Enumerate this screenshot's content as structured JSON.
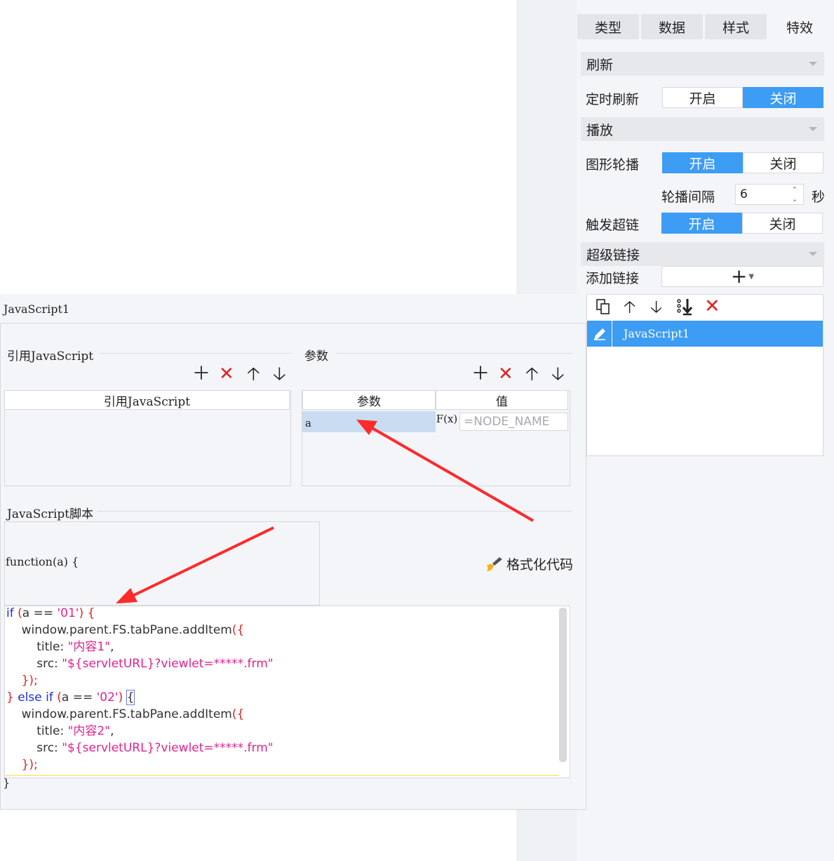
{
  "tabs": [
    {
      "label": "类型",
      "active": false
    },
    {
      "label": "数据",
      "active": false
    },
    {
      "label": "样式",
      "active": false
    },
    {
      "label": "特效",
      "active": true
    }
  ],
  "refresh": {
    "section": "刷新",
    "timer_label": "定时刷新",
    "on": "开启",
    "off": "关闭",
    "selected": "关闭"
  },
  "playback": {
    "section": "播放",
    "carousel_label": "图形轮播",
    "on": "开启",
    "off": "关闭",
    "selected": "开启",
    "interval_label": "轮播间隔",
    "interval_value": "6",
    "interval_unit": "秒",
    "trigger_label": "触发超链",
    "trigger_on": "开启",
    "trigger_off": "关闭",
    "trigger_selected": "开启"
  },
  "hyperlink": {
    "section": "超级链接",
    "add_label": "添加链接",
    "add_button": "+",
    "items": [
      "JavaScript1"
    ]
  },
  "dialog": {
    "name": "JavaScript1",
    "ref_js_group": "引用JavaScript",
    "ref_js_column": "引用JavaScript",
    "params_group": "参数",
    "param_col": "参数",
    "value_col": "值",
    "param_rows": [
      {
        "name": "a",
        "value": "=NODE_NAME",
        "fx": "F(x)"
      }
    ],
    "script_group": "JavaScript脚本",
    "function_sig": "function(a) {",
    "format_code": "格式化代码",
    "closing_brace": "}",
    "code_lines": [
      "if (a == '01') {",
      "    window.parent.FS.tabPane.addItem({",
      "        title: \"内容1\",",
      "        src: \"${servletURL}?viewlet=*****.frm\"",
      "    });",
      "} else if (a == '02') {",
      "    window.parent.FS.tabPane.addItem({",
      "        title: \"内容2\",",
      "        src: \"${servletURL}?viewlet=*****.frm\"",
      "    });"
    ]
  },
  "colors": {
    "accent": "#3d9cf3",
    "danger": "#e02424",
    "arrow": "#ff2a2a"
  }
}
